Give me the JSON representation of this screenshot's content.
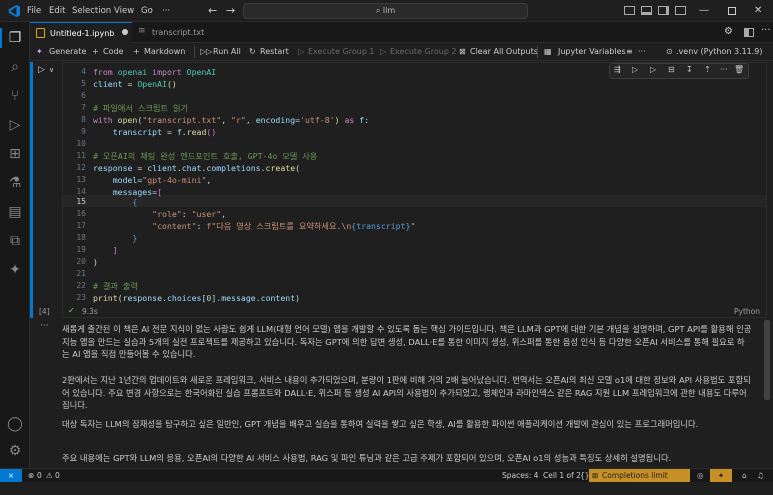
{
  "menu": {
    "file": "File",
    "edit": "Edit",
    "selection": "Selection",
    "view": "View",
    "go": "Go",
    "more": "···"
  },
  "search": {
    "value": "llm"
  },
  "tabs": [
    {
      "label": "Untitled-1.ipynb"
    },
    {
      "label": "transcript.txt"
    }
  ],
  "toolbar": {
    "generate": "Generate",
    "code": "Code",
    "markdown": "Markdown",
    "run_all": "Run All",
    "restart": "Restart",
    "exec_group_1": "Execute Group 1",
    "exec_group_2": "Execute Group 2",
    "clear_all": "Clear All Outputs",
    "jupyter_vars": "Jupyter Variables",
    "kernel": ".venv (Python 3.11.9)"
  },
  "cell": {
    "exec_count": "[4]",
    "time": "9.3s",
    "lang": "Python",
    "lines": [
      {
        "n": "4"
      },
      {
        "n": "5"
      },
      {
        "n": "6"
      },
      {
        "n": "7"
      },
      {
        "n": "8"
      },
      {
        "n": "9"
      },
      {
        "n": "10"
      },
      {
        "n": "11"
      },
      {
        "n": "12"
      },
      {
        "n": "13"
      },
      {
        "n": "14"
      },
      {
        "n": "15"
      },
      {
        "n": "16"
      },
      {
        "n": "17"
      },
      {
        "n": "18"
      },
      {
        "n": "19"
      },
      {
        "n": "20"
      },
      {
        "n": "21"
      },
      {
        "n": "22"
      },
      {
        "n": "23"
      }
    ],
    "code": {
      "l4a": "from",
      "l4b": " openai ",
      "l4c": "import",
      "l4d": " OpenAI",
      "l5a": "client",
      "l5b": " = ",
      "l5c": "OpenAI",
      "l5d": "()",
      "l7": "# 파일에서 스크립트 읽기",
      "l8a": "with",
      "l8b": " open",
      "l8c": "(",
      "l8d": "\"transcript.txt\"",
      "l8e": ", ",
      "l8f": "\"r\"",
      "l8g": ", encoding=",
      "l8h": "'utf-8'",
      "l8i": ") ",
      "l8j": "as",
      "l8k": " f:",
      "l9a": "    transcript",
      "l9b": " = ",
      "l9c": "f",
      "l9d": ".",
      "l9e": "read",
      "l9f": "()",
      "l11": "# 오픈AI의 채팅 완성 엔드포인트 호출, GPT-4o 모델 사용",
      "l12a": "response",
      "l12b": " = ",
      "l12c": "client",
      "l12d": ".chat.completions.",
      "l12e": "create",
      "l12f": "(",
      "l13a": "    model=",
      "l13b": "\"gpt-4o-mini\"",
      "l13c": ",",
      "l14a": "    messages=",
      "l14b": "[",
      "l15": "        {",
      "l16a": "            ",
      "l16b": "\"role\"",
      "l16c": ": ",
      "l16d": "\"user\"",
      "l16e": ",",
      "l17a": "            ",
      "l17b": "\"content\"",
      "l17c": ": ",
      "l17d": "f\"다음 영상 스크립트를 요약하세요.\\n",
      "l17e": "{transcript}",
      "l17f": "\"",
      "l18": "        }",
      "l19": "    ]",
      "l20": ")",
      "l22": "# 결과 출력",
      "l23a": "print",
      "l23b": "(",
      "l23c": "response",
      "l23d": ".choices[",
      "l23e": "0",
      "l23f": "].message.content)"
    }
  },
  "output": {
    "p1": "새롭게 출간된 이 책은 AI 전문 지식이 없는 사람도 쉽게 LLM(대형 언어 모델) 앱을 개발할 수 있도록 돕는 핵심 가이드입니다. 책은 LLM과 GPT에 대한 기본 개념을 설명하며, GPT API를 활용해 인공지능 앱을 만드는 실습과 5개의 실전 프로젝트를 제공하고 있습니다. 독자는 GPT에 의한 답변 생성, DALL·E를 통한 이미지 생성, 위스퍼를 통한 음성 인식 등 다양한 오픈AI 서비스를 통해 필요로 하는 AI 앱을 직접 만들어볼 수 있습니다.",
    "p2": "2판에서는 지난 1년간의 업데이트와 새로운 프레임워크, 서비스 내용이 추가되었으며, 분량이 1판에 비해 거의 2배 늘어났습니다. 번역서는 오픈AI의 최신 모델 o1에 대한 정보와 API 사용법도 포함되어 있습니다. 주요 변경 사항으로는 한국어화된 실습 프롬프트와 DALL·E, 위스퍼 등 생성 AI API의 사용법이 추가되었고, 랭체인과 라마인덱스 같은 RAG 지원 LLM 프레임워크에 관한 내용도 다루어집니다.",
    "p3": "대상 독자는 LLM의 잠재성을 탐구하고 싶은 일반인, GPT 개념을 배우고 실습을 통하여 실력을 쌓고 싶은 학생, AI를 활용한 파이썬 애플리케이션 개발에 관심이 있는 프로그래머입니다.",
    "p4": "주요 내용에는 GPT와 LLM의 응용, 오픈AI의 다양한 AI 서비스 사용법, RAG 및 파인 튜닝과 같은 고급 주제가 포함되어 있으며, 오픈AI o1의 성능과 특징도 상세히 설명됩니다."
  },
  "status": {
    "errors": "0",
    "warnings": "0",
    "spaces": "Spaces: 4",
    "cell": "Cell 1 of 2",
    "completions": "Completions limit reached"
  },
  "colors": {
    "accent": "#0078d4",
    "status_warn": "#c69026"
  }
}
